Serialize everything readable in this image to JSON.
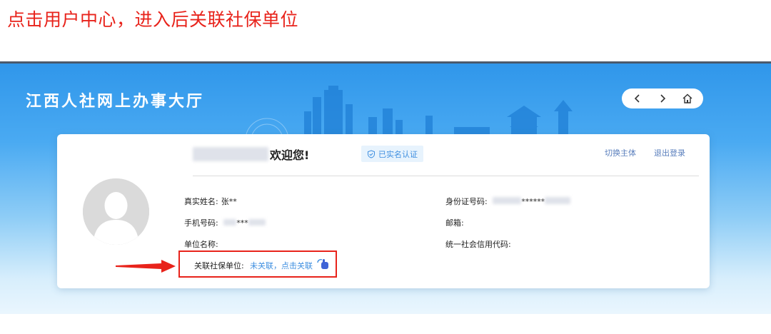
{
  "instruction": "点击用户中心，进入后关联社保单位",
  "portal": {
    "title": "江西人社网上办事大厅",
    "nav": {
      "back_glyph": "‹",
      "forward_glyph": "›",
      "home_icon": "home-icon"
    }
  },
  "profile": {
    "welcome": "欢迎您!",
    "verified_badge": "已实名认证",
    "switch_entity": "切换主体",
    "logout": "退出登录",
    "fields": {
      "real_name_label": "真实姓名:",
      "real_name_value": "张**",
      "id_label": "身份证号码:",
      "id_value": "******",
      "phone_label": "手机号码:",
      "phone_value": "***",
      "email_label": "邮箱:",
      "email_value": "",
      "company_label": "单位名称:",
      "company_value": "",
      "credit_code_label": "统一社会信用代码:",
      "credit_code_value": ""
    },
    "association": {
      "label": "关联社保单位:",
      "link": "未关联，点击关联"
    }
  },
  "colors": {
    "annotation_red": "#e8231b",
    "link_blue": "#3f8fe0",
    "banner_blue": "#2f96ea"
  }
}
